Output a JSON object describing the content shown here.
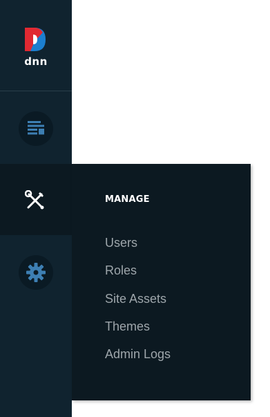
{
  "logo": {
    "text": "dnn",
    "colors": {
      "red": "#e02932",
      "blue": "#1c7fcf"
    }
  },
  "sidebar": {
    "items": [
      {
        "id": "content",
        "icon": "content-layout-icon"
      },
      {
        "id": "manage",
        "icon": "wrench-screwdriver-icon",
        "active": true
      },
      {
        "id": "settings",
        "icon": "gear-icon"
      }
    ]
  },
  "flyout": {
    "title": "MANAGE",
    "items": [
      {
        "label": "Users"
      },
      {
        "label": "Roles"
      },
      {
        "label": "Site Assets"
      },
      {
        "label": "Themes"
      },
      {
        "label": "Admin Logs"
      }
    ]
  },
  "colors": {
    "sidebar_bg": "#10232f",
    "flyout_bg": "#0c1921",
    "icon_blue": "#3d7fb3",
    "menu_text": "#9ea6ab"
  }
}
